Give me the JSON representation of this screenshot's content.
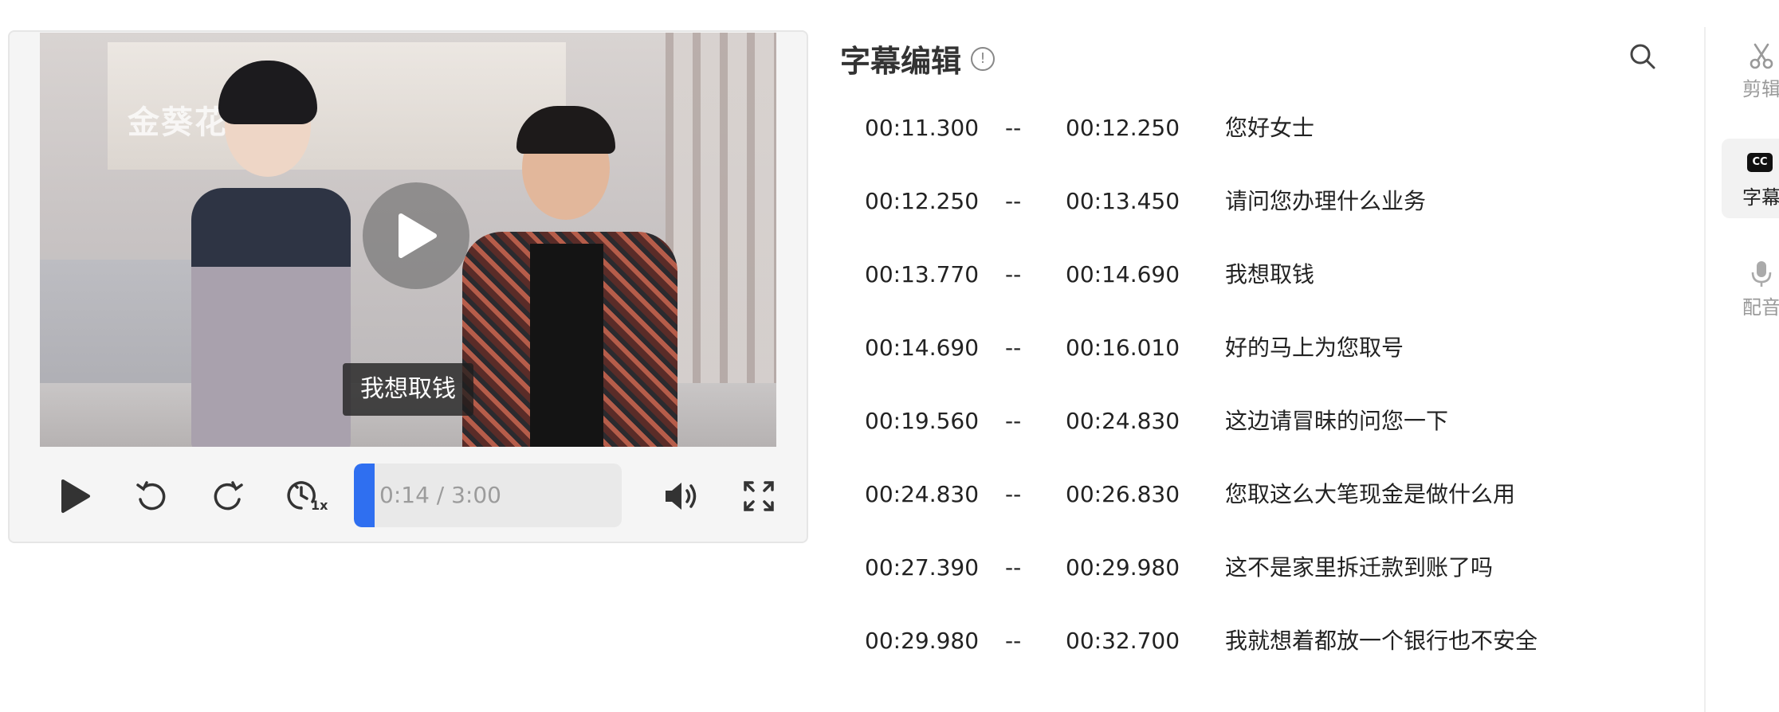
{
  "player": {
    "subtitle_overlay": "我想取钱",
    "progress_text": "0:14 / 3:00",
    "progress_fraction": 0.078,
    "speed_badge": "1x",
    "video_wall_text": "金葵花理"
  },
  "panel": {
    "title": "字幕编辑",
    "info_glyph": "!"
  },
  "subtitles": [
    {
      "start": "00:11.300",
      "sep": "--",
      "end": "00:12.250",
      "text": "您好女士"
    },
    {
      "start": "00:12.250",
      "sep": "--",
      "end": "00:13.450",
      "text": "请问您办理什么业务"
    },
    {
      "start": "00:13.770",
      "sep": "--",
      "end": "00:14.690",
      "text": "我想取钱"
    },
    {
      "start": "00:14.690",
      "sep": "--",
      "end": "00:16.010",
      "text": "好的马上为您取号"
    },
    {
      "start": "00:19.560",
      "sep": "--",
      "end": "00:24.830",
      "text": "这边请冒昧的问您一下"
    },
    {
      "start": "00:24.830",
      "sep": "--",
      "end": "00:26.830",
      "text": "您取这么大笔现金是做什么用"
    },
    {
      "start": "00:27.390",
      "sep": "--",
      "end": "00:29.980",
      "text": "这不是家里拆迁款到账了吗"
    },
    {
      "start": "00:29.980",
      "sep": "--",
      "end": "00:32.700",
      "text": "我就想着都放一个银行也不安全"
    }
  ],
  "rail": {
    "items": [
      {
        "label": "剪辑",
        "icon": "scissors-icon"
      },
      {
        "label": "字幕",
        "icon": "cc-icon",
        "badge": "CC"
      },
      {
        "label": "配音",
        "icon": "microphone-icon"
      }
    ]
  },
  "colors": {
    "accent": "#2f6ff0"
  }
}
